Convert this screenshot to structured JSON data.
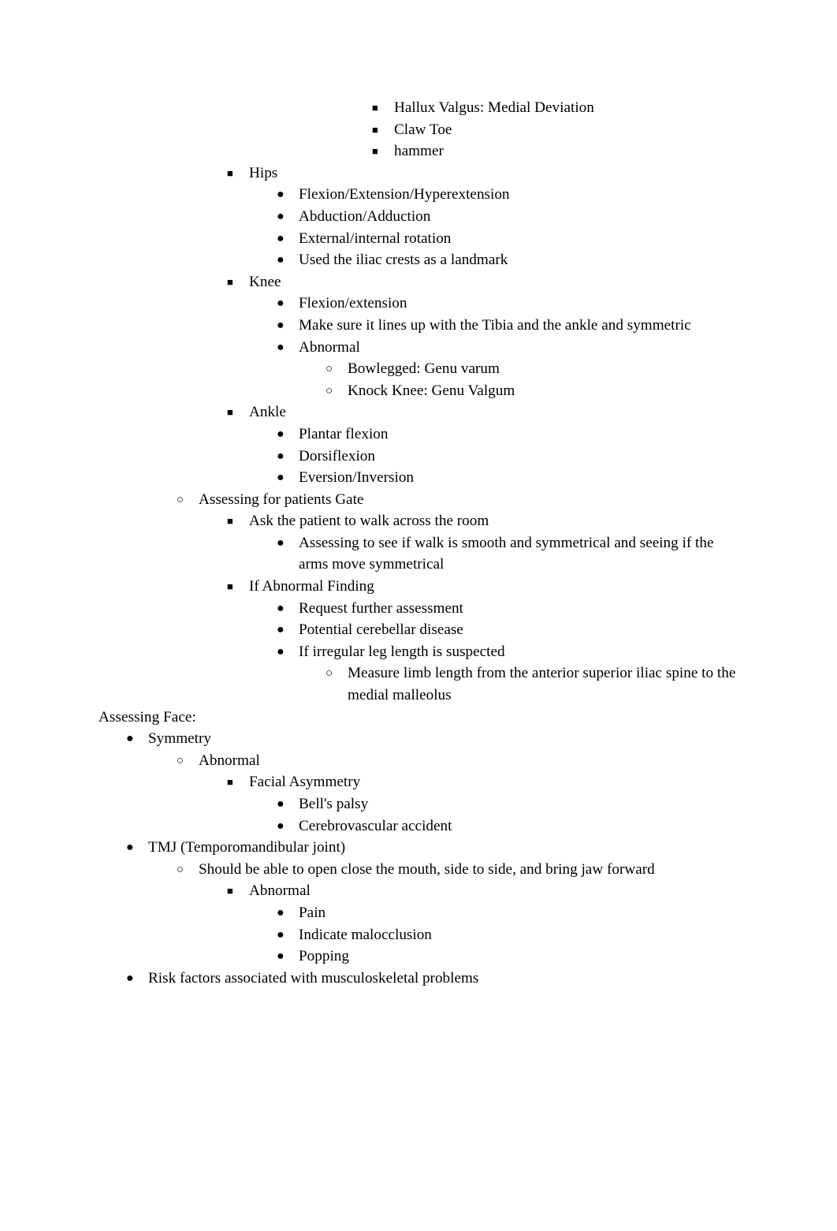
{
  "document": {
    "title_line": "Assessing Face:",
    "markers": {
      "square": "■",
      "disc": "●",
      "circle": "○"
    },
    "blocks": [
      {
        "id": "b0",
        "level": 6,
        "marker": "square",
        "text": "Hallux Valgus: Medial Deviation"
      },
      {
        "id": "b1",
        "level": 6,
        "marker": "square",
        "text": "Claw Toe"
      },
      {
        "id": "b2",
        "level": 6,
        "marker": "square",
        "text": "hammer"
      },
      {
        "id": "b3",
        "level": 3,
        "marker": "square",
        "text": "Hips"
      },
      {
        "id": "b4",
        "level": 4,
        "marker": "disc",
        "text": "Flexion/Extension/Hyperextension"
      },
      {
        "id": "b5",
        "level": 4,
        "marker": "disc",
        "text": "Abduction/Adduction"
      },
      {
        "id": "b6",
        "level": 4,
        "marker": "disc",
        "text": "External/internal rotation"
      },
      {
        "id": "b7",
        "level": 4,
        "marker": "disc",
        "text": "Used the iliac crests as a landmark"
      },
      {
        "id": "b8",
        "level": 3,
        "marker": "square",
        "text": "Knee"
      },
      {
        "id": "b9",
        "level": 4,
        "marker": "disc",
        "text": "Flexion/extension"
      },
      {
        "id": "b10",
        "level": 4,
        "marker": "disc",
        "text": "Make sure it lines up with the Tibia and the ankle and symmetric"
      },
      {
        "id": "b11",
        "level": 4,
        "marker": "disc",
        "text": "Abnormal"
      },
      {
        "id": "b12",
        "level": 5,
        "marker": "circle",
        "text": "Bowlegged: Genu varum"
      },
      {
        "id": "b13",
        "level": 5,
        "marker": "circle",
        "text": "Knock Knee: Genu Valgum"
      },
      {
        "id": "b14",
        "level": 3,
        "marker": "square",
        "text": "Ankle"
      },
      {
        "id": "b15",
        "level": 4,
        "marker": "disc",
        "text": "Plantar flexion"
      },
      {
        "id": "b16",
        "level": 4,
        "marker": "disc",
        "text": "Dorsiflexion"
      },
      {
        "id": "b17",
        "level": 4,
        "marker": "disc",
        "text": "Eversion/Inversion"
      },
      {
        "id": "b18",
        "level": 2,
        "marker": "circle",
        "text": "Assessing for patients Gate"
      },
      {
        "id": "b19",
        "level": 3,
        "marker": "square",
        "text": "Ask the patient to walk across the room"
      },
      {
        "id": "b20",
        "level": 4,
        "marker": "disc",
        "text": "Assessing to see if walk is smooth and symmetrical and seeing if the arms move symmetrical"
      },
      {
        "id": "b21",
        "level": 3,
        "marker": "square",
        "text": "If Abnormal Finding"
      },
      {
        "id": "b22",
        "level": 4,
        "marker": "disc",
        "text": "Request further assessment"
      },
      {
        "id": "b23",
        "level": 4,
        "marker": "disc",
        "text": "Potential cerebellar disease"
      },
      {
        "id": "b24",
        "level": 4,
        "marker": "disc",
        "text": "If irregular leg length is suspected"
      },
      {
        "id": "b25",
        "level": 5,
        "marker": "circle",
        "text": "Measure limb length from the anterior superior iliac spine to the medial malleolus"
      },
      {
        "id": "b26",
        "level": 0,
        "marker": "none",
        "text": "Assessing Face:"
      },
      {
        "id": "b27",
        "level": 1,
        "marker": "disc",
        "text": "Symmetry"
      },
      {
        "id": "b28",
        "level": 2,
        "marker": "circle",
        "text": "Abnormal"
      },
      {
        "id": "b29",
        "level": 3,
        "marker": "square",
        "text": "Facial Asymmetry"
      },
      {
        "id": "b30",
        "level": 4,
        "marker": "disc",
        "text": "Bell's palsy"
      },
      {
        "id": "b31",
        "level": 4,
        "marker": "disc",
        "text": "Cerebrovascular accident"
      },
      {
        "id": "b32",
        "level": 1,
        "marker": "disc",
        "text": "TMJ (Temporomandibular joint)"
      },
      {
        "id": "b33",
        "level": 2,
        "marker": "circle",
        "text": "Should be able to open close the mouth, side to side, and bring jaw forward"
      },
      {
        "id": "b34",
        "level": 3,
        "marker": "square",
        "text": "Abnormal"
      },
      {
        "id": "b35",
        "level": 4,
        "marker": "disc",
        "text": "Pain"
      },
      {
        "id": "b36",
        "level": 4,
        "marker": "disc",
        "text": "Indicate malocclusion"
      },
      {
        "id": "b37",
        "level": 4,
        "marker": "disc",
        "text": "Popping"
      },
      {
        "id": "b38",
        "level": 1,
        "marker": "disc",
        "text": "Risk factors associated with musculoskeletal problems"
      }
    ]
  }
}
